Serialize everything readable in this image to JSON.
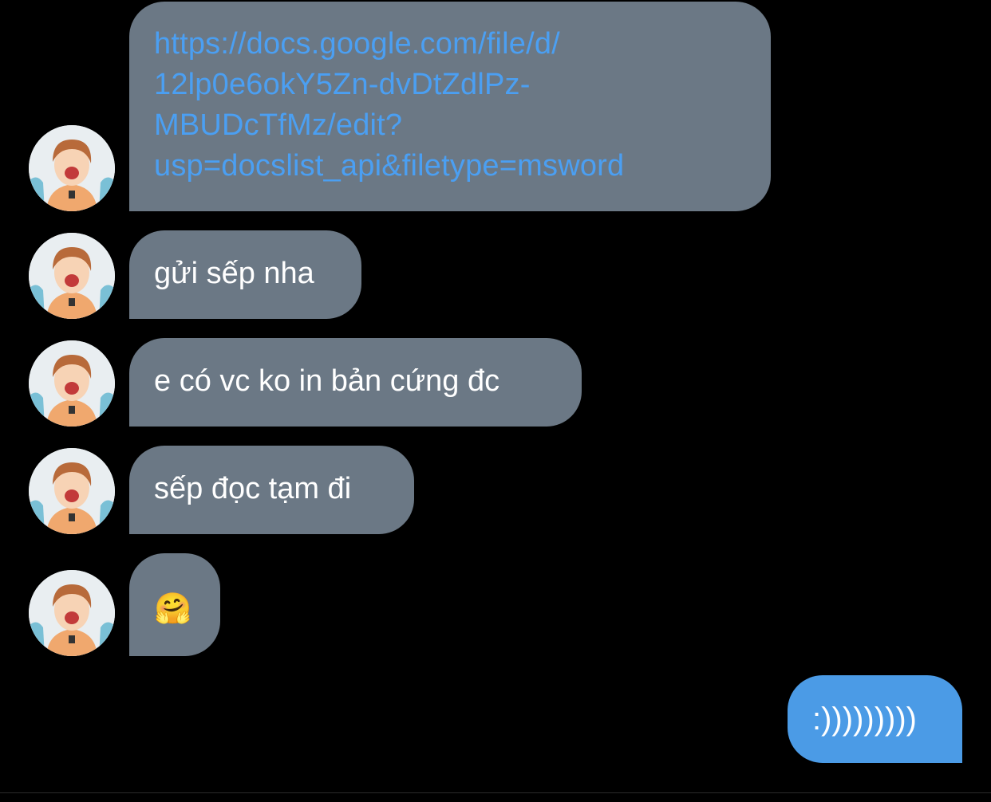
{
  "conversation": {
    "messages": [
      {
        "sender": "contact",
        "type": "link",
        "text": "https://docs.google.com/file/d/\n12lp0e6okY5Zn-dvDtZdlPz-\nMBUDcTfMz/edit?\nusp=docslist_api&filetype=msword"
      },
      {
        "sender": "contact",
        "type": "text",
        "text": "gửi sếp nha"
      },
      {
        "sender": "contact",
        "type": "text",
        "text": "e có vc ko in bản cứng đc"
      },
      {
        "sender": "contact",
        "type": "text",
        "text": "sếp đọc tạm đi"
      },
      {
        "sender": "contact",
        "type": "emoji",
        "text": "🤗"
      },
      {
        "sender": "self",
        "type": "text",
        "text": ":)))))))))"
      }
    ]
  },
  "colors": {
    "background": "#000000",
    "incoming_bubble": "#6b7885",
    "outgoing_bubble": "#4b9be6",
    "link": "#4b9ff2",
    "text": "#ffffff"
  },
  "icons": {
    "avatar": "contact-avatar-photo"
  }
}
